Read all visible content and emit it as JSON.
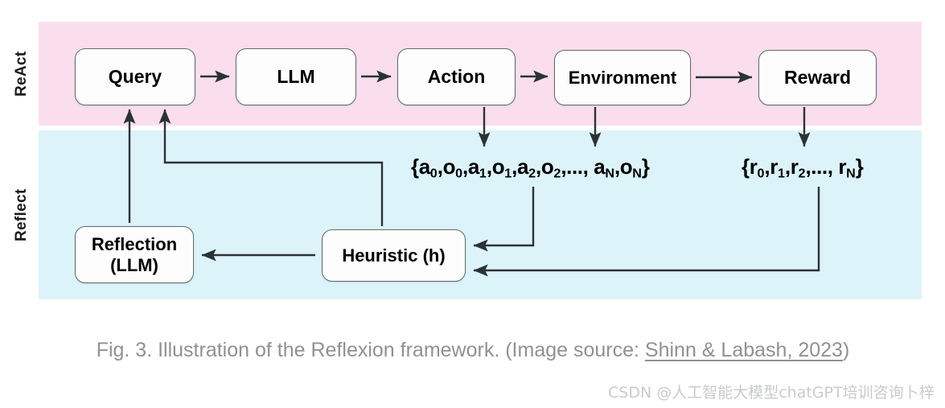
{
  "figure": {
    "bands": [
      {
        "id": "react",
        "label": "ReAct",
        "color": "#fbdeee"
      },
      {
        "id": "reflect",
        "label": "Reflect",
        "color": "#ddf3fa"
      }
    ],
    "nodes": {
      "query": "Query",
      "llm": "LLM",
      "action": "Action",
      "environment": "Environment",
      "reward": "Reward",
      "reflection_line1": "Reflection",
      "reflection_line2": "(LLM)",
      "heuristic": "Heuristic (h)"
    },
    "notation": {
      "trajectory_prefix": "{a",
      "trajectory_full": "{a0,o0,a1,o1,a2,o2,..., aN,oN}",
      "rewards_full": "{r0,r1,r2,..., rN}",
      "trajectory_parts": [
        "{a",
        "0",
        ",o",
        "0",
        ",a",
        "1",
        ",o",
        "1",
        ",a",
        "2",
        ",o",
        "2",
        ",..., a",
        "N",
        ",o",
        "N",
        "}"
      ],
      "rewards_parts": [
        "{r",
        "0",
        ",r",
        "1",
        ",r",
        "2",
        ",..., r",
        "N",
        "}"
      ]
    },
    "arrow_color": "#2b3236"
  },
  "caption": {
    "text_before": "Fig. 3. Illustration of the Reflexion framework. (Image source: ",
    "link_text": "Shinn & Labash, 2023",
    "text_after": ")"
  },
  "watermark": {
    "text": "CSDN @人工智能大模型chatGPT培训咨询卜梓"
  }
}
